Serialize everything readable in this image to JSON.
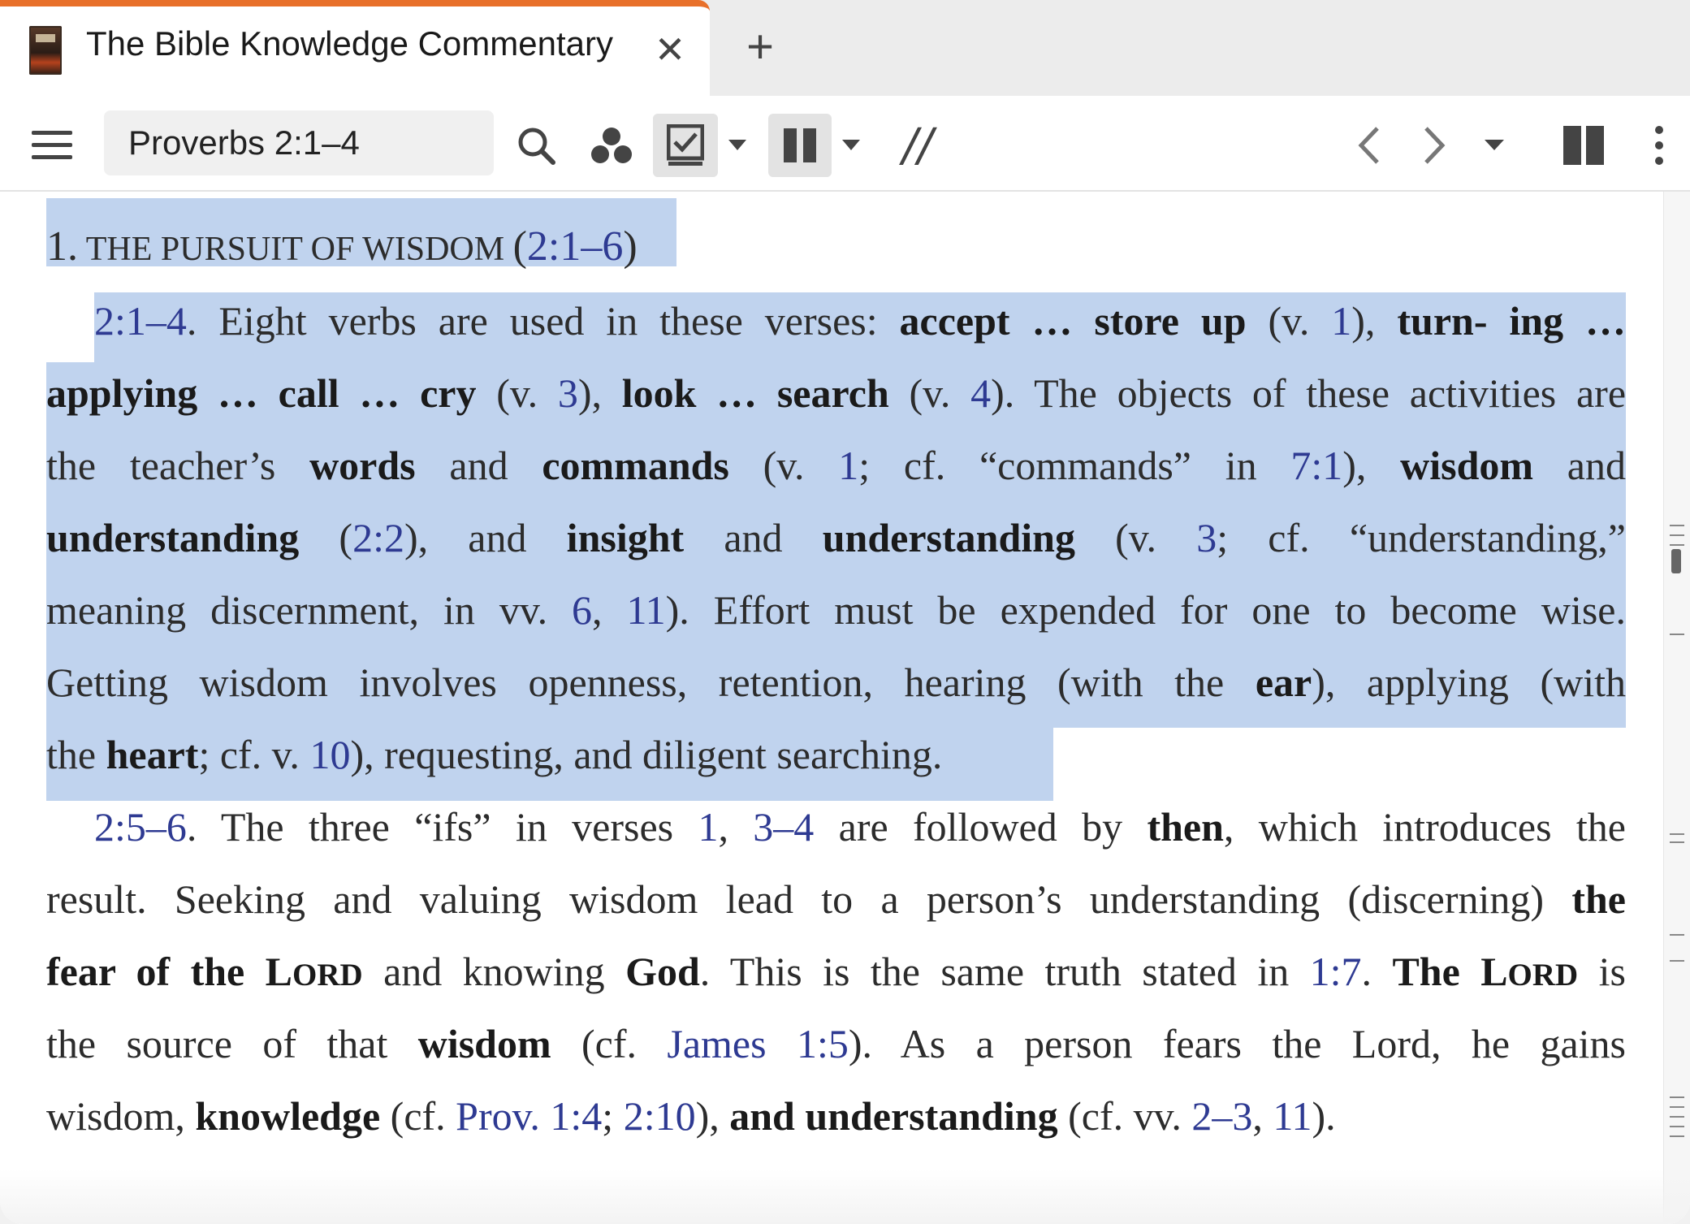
{
  "tab": {
    "title": "The Bible Knowledge Commentary",
    "close": "✕",
    "new_tab": "+"
  },
  "toolbar": {
    "reference_value": "Proverbs 2:1–4",
    "interlinear_label": "//"
  },
  "content": {
    "heading": {
      "number": "1.",
      "title": "THE PURSUIT OF WISDOM",
      "open": "(",
      "ref": "2:1–6",
      "close": ")"
    },
    "p1": {
      "ref": "2:1–4",
      "t1": ". Eight verbs are used in these verses: ",
      "b1": "accept … store up",
      "t2": " (v. ",
      "r1": "1",
      "t3": "), ",
      "b2": "turn- ing …",
      "l2_b1": "applying … call … cry",
      "l2_t1": " (v. ",
      "l2_r1": "3",
      "l2_t2": "), ",
      "l2_b2": "look … search",
      "l2_t3": " (v. ",
      "l2_r2": "4",
      "l2_t4": "). The objects of these activities are",
      "l3_t1": "the teacher’s ",
      "l3_b1": "words",
      "l3_t2": " and ",
      "l3_b2": "commands",
      "l3_t3": " (v. ",
      "l3_r1": "1",
      "l3_t4": "; cf. “commands” in ",
      "l3_r2": "7:1",
      "l3_t5": "), ",
      "l3_b3": "wisdom",
      "l3_t6": " and",
      "l4_b1": "understanding",
      "l4_t1": " (",
      "l4_r1": "2:2",
      "l4_t2": "), and ",
      "l4_b2": "insight",
      "l4_t3": " and ",
      "l4_b3": "understanding",
      "l4_t4": " (v. ",
      "l4_r2": "3",
      "l4_t5": "; cf. “understanding,”",
      "l5_t1": "meaning discernment, in vv. ",
      "l5_r1": "6",
      "l5_t2": ", ",
      "l5_r2": "11",
      "l5_t3": "). Effort must be expended for one to become wise.",
      "l6_t1": "Getting wisdom involves openness, retention, hearing (with the ",
      "l6_b1": "ear",
      "l6_t2": "), applying (with",
      "l7_t1": "the ",
      "l7_b1": "heart",
      "l7_t2": "; cf. v. ",
      "l7_r1": "10",
      "l7_t3": "), requesting, and diligent searching."
    },
    "p2": {
      "ref": "2:5–6",
      "t1": ". The three “ifs” in verses ",
      "r1": "1",
      "t2": ", ",
      "r2": "3–4",
      "t3": " are followed by ",
      "b1": "then",
      "t4": ", which introduces the",
      "l2_t1": "result. Seeking and valuing wisdom lead to a person’s understanding (discerning) ",
      "l2_b1": "the",
      "l3_b1": "fear of the L",
      "l3_sc1": "ORD",
      "l3_t1": " and knowing ",
      "l3_b2": "God",
      "l3_t2": ". This is the same truth stated in ",
      "l3_r1": "1:7",
      "l3_t3": ". ",
      "l3_b3": "The L",
      "l3_sc2": "ORD",
      "l3_t4": " is",
      "l4_t1": "the source of that ",
      "l4_b1": "wisdom",
      "l4_t2": " (cf. ",
      "l4_r1": "James 1:5",
      "l4_t3": "). As a person fears the Lord, he gains",
      "l5_t1": "wisdom, ",
      "l5_b1": "knowledge",
      "l5_t2": " (cf. ",
      "l5_r1": "Prov. 1:4",
      "l5_t3": "; ",
      "l5_r2": "2:10",
      "l5_t4": "), ",
      "l5_b2": "and understanding",
      "l5_t5": " (cf. vv. ",
      "l5_r3": "2–3",
      "l5_t6": ", ",
      "l5_r4": "11",
      "l5_t7": ")."
    }
  },
  "colors": {
    "accent": "#e8702a",
    "selection": "#c0d3ee",
    "link": "#2e3a92"
  }
}
